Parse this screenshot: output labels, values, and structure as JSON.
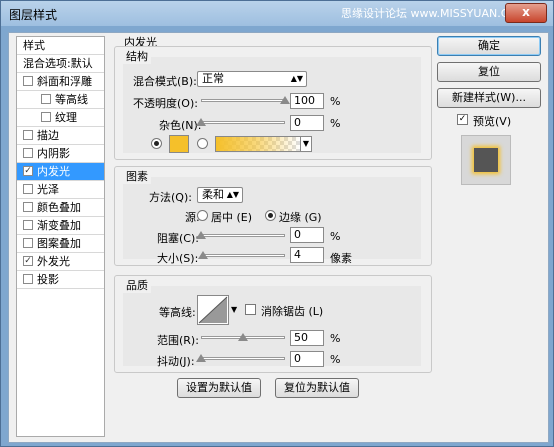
{
  "window": {
    "title": "图层样式",
    "watermark": "思缘设计论坛 www.MISSYUAN.COM",
    "close": "x"
  },
  "left_panel": {
    "header": "样式",
    "blend_options": "混合选项:默认",
    "items": [
      {
        "label": "斜面和浮雕",
        "checked": false,
        "selected": false
      },
      {
        "label": "等高线",
        "checked": false,
        "selected": false
      },
      {
        "label": "纹理",
        "checked": false,
        "selected": false
      },
      {
        "label": "描边",
        "checked": false,
        "selected": false
      },
      {
        "label": "内阴影",
        "checked": false,
        "selected": false
      },
      {
        "label": "内发光",
        "checked": true,
        "selected": true
      },
      {
        "label": "光泽",
        "checked": false,
        "selected": false
      },
      {
        "label": "颜色叠加",
        "checked": false,
        "selected": false
      },
      {
        "label": "渐变叠加",
        "checked": false,
        "selected": false
      },
      {
        "label": "图案叠加",
        "checked": false,
        "selected": false
      },
      {
        "label": "外发光",
        "checked": true,
        "selected": false
      },
      {
        "label": "投影",
        "checked": false,
        "selected": false
      }
    ]
  },
  "panel": {
    "title": "内发光",
    "structure": {
      "title": "结构",
      "blend_mode_label": "混合模式(B):",
      "blend_mode_value": "正常",
      "opacity_label": "不透明度(O):",
      "opacity_value": "100",
      "opacity_unit": "%",
      "opacity_level": 100,
      "noise_label": "杂色(N):",
      "noise_value": "0",
      "noise_unit": "%",
      "noise_level": 0,
      "glow_color": "#f5c02a"
    },
    "elements": {
      "title": "图素",
      "technique_label": "方法(Q):",
      "technique_value": "柔和",
      "source_label": "源:",
      "source_center": "居中 (E)",
      "source_edge": "边缘 (G)",
      "choke_label": "阻塞(C):",
      "choke_value": "0",
      "choke_unit": "%",
      "choke_level": 0,
      "size_label": "大小(S):",
      "size_value": "4",
      "size_unit": "像素",
      "size_level": 2
    },
    "quality": {
      "title": "品质",
      "contour_label": "等高线:",
      "antialias_label": "消除锯齿 (L)",
      "range_label": "范围(R):",
      "range_value": "50",
      "range_unit": "%",
      "range_level": 50,
      "jitter_label": "抖动(J):",
      "jitter_value": "0",
      "jitter_unit": "%",
      "jitter_level": 0
    },
    "make_default": "设置为默认值",
    "reset_default": "复位为默认值"
  },
  "right": {
    "ok": "确定",
    "reset": "复位",
    "new_style": "新建样式(W)...",
    "preview_label": "预览(V)",
    "preview_checked": true
  }
}
